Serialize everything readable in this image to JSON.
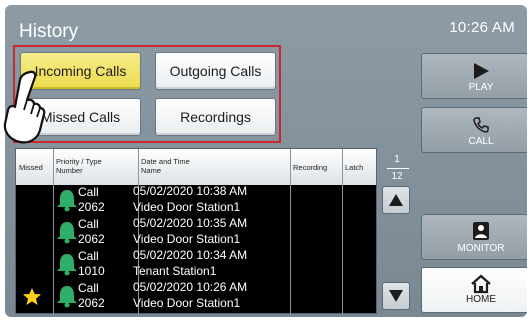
{
  "header": {
    "title": "History",
    "clock": "10:26 AM"
  },
  "filters": [
    {
      "label": "Incoming Calls",
      "active": true
    },
    {
      "label": "Outgoing Calls",
      "active": false
    },
    {
      "label": "Missed Calls",
      "active": false
    },
    {
      "label": "Recordings",
      "active": false
    }
  ],
  "side_buttons": {
    "play": "PLAY",
    "call": "CALL",
    "monitor": "MONITOR",
    "home": "HOME"
  },
  "table": {
    "headers": {
      "missed": "Missed",
      "priority_line1": "Priority / Type",
      "priority_line2": "Number",
      "datetime_line1": "Date and Time",
      "datetime_line2": "Name",
      "recording": "Recording",
      "latch": "Latch"
    },
    "rows": [
      {
        "type": "Call",
        "number": "2062",
        "datetime": "05/02/2020 10:38 AM",
        "name": "Video Door Station1",
        "missed": false,
        "icon": "bell-icon"
      },
      {
        "type": "Call",
        "number": "2062",
        "datetime": "05/02/2020 10:35 AM",
        "name": "Video Door Station1",
        "missed": false,
        "icon": "bell-icon"
      },
      {
        "type": "Call",
        "number": "1010",
        "datetime": "05/02/2020 10:34 AM",
        "name": "Tenant Station1",
        "missed": false,
        "icon": "bell-icon"
      },
      {
        "type": "Call",
        "number": "2062",
        "datetime": "05/02/2020 10:26 AM",
        "name": "Video Door Station1",
        "missed": true,
        "icon": "bell-icon"
      }
    ]
  },
  "pager": {
    "current": "1",
    "total": "12"
  },
  "colors": {
    "accent_red": "#c8282e",
    "active_yellow": "#eddb4a",
    "bell_green": "#2fae6a",
    "star_yellow": "#ffd21a"
  }
}
